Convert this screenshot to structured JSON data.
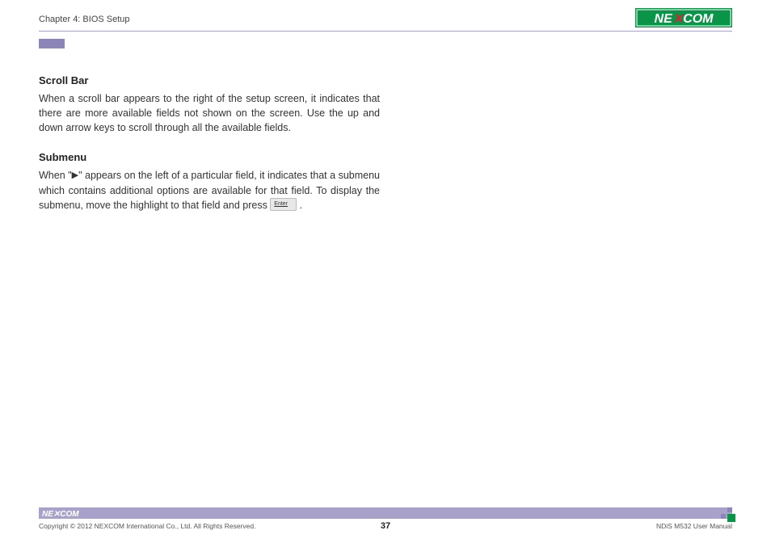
{
  "header": {
    "chapter": "Chapter 4: BIOS Setup",
    "logo_text": "NEXCOM"
  },
  "sections": {
    "s1": {
      "heading": "Scroll Bar",
      "text": "When a scroll bar appears to the right of the setup screen, it indicates that there are more available fields not shown on the screen. Use the up and down arrow keys to scroll through all the available fields."
    },
    "s2": {
      "heading": "Submenu",
      "text_before": "When \"",
      "arrow": "▶",
      "text_mid": "\" appears on the left of a particular field, it indicates that a submenu which contains additional options are available for that field. To display the submenu, move the highlight to that field and press ",
      "key": "Enter",
      "text_after": " ."
    }
  },
  "footer": {
    "logo_text": "NE COM",
    "copyright": "Copyright © 2012 NEXCOM International Co., Ltd. All Rights Reserved.",
    "page_number": "37",
    "manual": "NDiS M532 User Manual"
  }
}
